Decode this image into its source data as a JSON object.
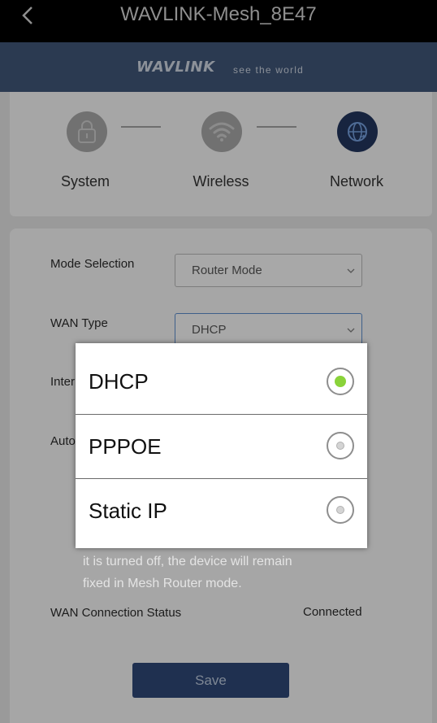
{
  "header": {
    "title": "WAVLINK-Mesh_8E47",
    "back_icon": "chevron-left-icon"
  },
  "brand": {
    "logo": "WAVLINK",
    "tagline": "see the world"
  },
  "steps": [
    {
      "label": "System",
      "icon": "lock-icon",
      "state": "done"
    },
    {
      "label": "Wireless",
      "icon": "wifi-icon",
      "state": "done"
    },
    {
      "label": "Network",
      "icon": "globe-icon",
      "state": "active"
    }
  ],
  "form": {
    "mode_label": "Mode Selection",
    "mode_value": "Router Mode",
    "wan_label": "WAN Type",
    "wan_value": "DHCP",
    "internet_label_partial": "Inter",
    "auto_label_partial": "Auto",
    "desc_line1": "it is turned off, the device will remain",
    "desc_line2": "fixed in Mesh Router mode.",
    "status_label": "WAN Connection Status",
    "status_value": "Connected",
    "save_label": "Save"
  },
  "wan_options": [
    {
      "label": "DHCP",
      "selected": true
    },
    {
      "label": "PPPOE",
      "selected": false
    },
    {
      "label": "Static IP",
      "selected": false
    }
  ],
  "colors": {
    "brand_bar": "#2b3a51",
    "active_step": "#17243f",
    "radio_selected": "#8ad33a",
    "save_button": "#1f3050"
  }
}
